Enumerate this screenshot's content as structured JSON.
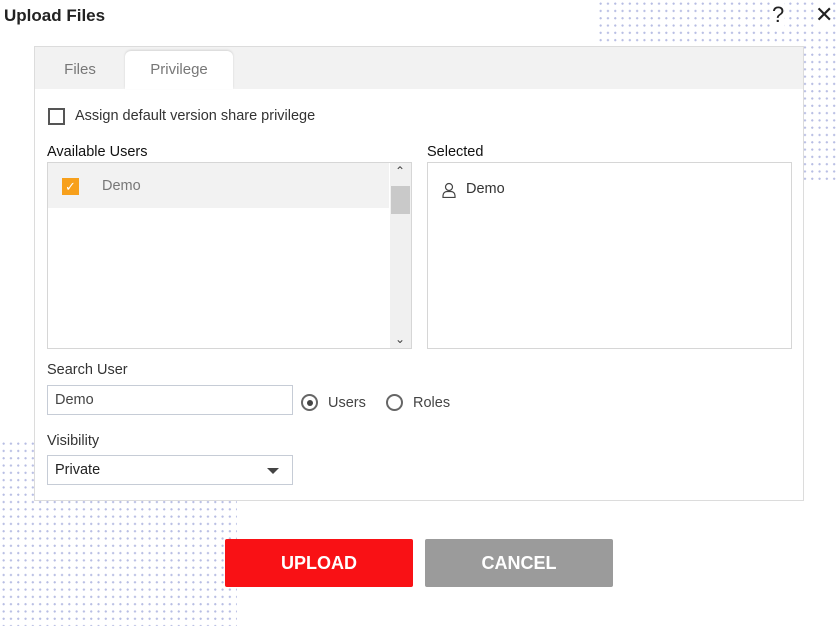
{
  "dialog": {
    "title": "Upload Files",
    "help_icon": "question-icon",
    "close_icon": "close-icon"
  },
  "tabs": [
    {
      "label": "Files",
      "active": false
    },
    {
      "label": "Privilege",
      "active": true
    }
  ],
  "privilege": {
    "assign_default_label": "Assign default version share privilege",
    "assign_default_checked": false,
    "available_users_label": "Available Users",
    "available_users": [
      {
        "name": "Demo",
        "checked": true
      }
    ],
    "selected_label": "Selected",
    "selected_users": [
      {
        "name": "Demo",
        "icon": "user-icon"
      }
    ],
    "search_user_label": "Search User",
    "search_user_value": "Demo",
    "search_mode_options": [
      {
        "label": "Users",
        "selected": true
      },
      {
        "label": "Roles",
        "selected": false
      }
    ],
    "visibility_label": "Visibility",
    "visibility_value": "Private"
  },
  "buttons": {
    "upload": "UPLOAD",
    "cancel": "CANCEL"
  },
  "colors": {
    "upload": "#f91115",
    "cancel": "#9b9b9b",
    "checkbox_checked": "#f7a01c"
  }
}
